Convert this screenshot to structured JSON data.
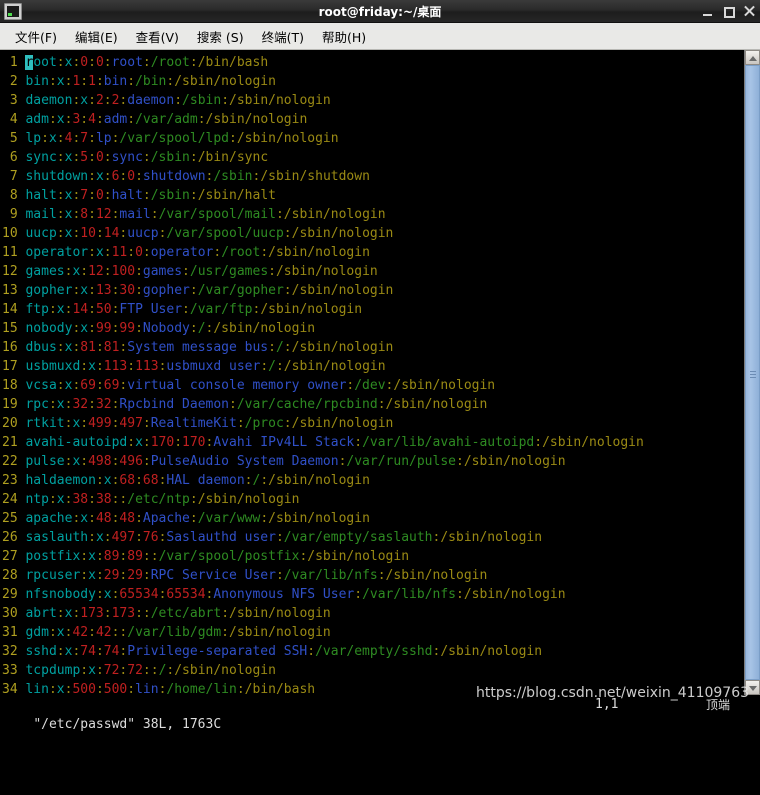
{
  "window": {
    "title": "root@friday:~/桌面",
    "icon": "terminal-icon",
    "buttons": {
      "minimize": "_",
      "maximize": "□",
      "close": "✕"
    }
  },
  "menubar": {
    "items": [
      {
        "label": "文件(F)"
      },
      {
        "label": "编辑(E)"
      },
      {
        "label": "查看(V)"
      },
      {
        "label": "搜索 (S)"
      },
      {
        "label": "终端(T)"
      },
      {
        "label": "帮助(H)"
      }
    ]
  },
  "editor": {
    "program": "vim",
    "colors": {
      "background": "#000000",
      "line_number": "#b0a020",
      "username": "#00a0a0",
      "separator": "#9a8a14",
      "uid_gid": "#c02020",
      "gecos": "#3050c8",
      "home_path": "#2e8b22",
      "shell": "#9a8a14",
      "cursor": "#2fbfbf"
    },
    "cursor": {
      "line": 1,
      "column": 1,
      "char": "r"
    },
    "lines": [
      {
        "n": "1",
        "user": "root",
        "x": "x",
        "uid": "0",
        "gid": "0",
        "gecos": "root",
        "home": "/root",
        "shell": "/bin/bash"
      },
      {
        "n": "2",
        "user": "bin",
        "x": "x",
        "uid": "1",
        "gid": "1",
        "gecos": "bin",
        "home": "/bin",
        "shell": "/sbin/nologin"
      },
      {
        "n": "3",
        "user": "daemon",
        "x": "x",
        "uid": "2",
        "gid": "2",
        "gecos": "daemon",
        "home": "/sbin",
        "shell": "/sbin/nologin"
      },
      {
        "n": "4",
        "user": "adm",
        "x": "x",
        "uid": "3",
        "gid": "4",
        "gecos": "adm",
        "home": "/var/adm",
        "shell": "/sbin/nologin"
      },
      {
        "n": "5",
        "user": "lp",
        "x": "x",
        "uid": "4",
        "gid": "7",
        "gecos": "lp",
        "home": "/var/spool/lpd",
        "shell": "/sbin/nologin"
      },
      {
        "n": "6",
        "user": "sync",
        "x": "x",
        "uid": "5",
        "gid": "0",
        "gecos": "sync",
        "home": "/sbin",
        "shell": "/bin/sync"
      },
      {
        "n": "7",
        "user": "shutdown",
        "x": "x",
        "uid": "6",
        "gid": "0",
        "gecos": "shutdown",
        "home": "/sbin",
        "shell": "/sbin/shutdown"
      },
      {
        "n": "8",
        "user": "halt",
        "x": "x",
        "uid": "7",
        "gid": "0",
        "gecos": "halt",
        "home": "/sbin",
        "shell": "/sbin/halt"
      },
      {
        "n": "9",
        "user": "mail",
        "x": "x",
        "uid": "8",
        "gid": "12",
        "gecos": "mail",
        "home": "/var/spool/mail",
        "shell": "/sbin/nologin"
      },
      {
        "n": "10",
        "user": "uucp",
        "x": "x",
        "uid": "10",
        "gid": "14",
        "gecos": "uucp",
        "home": "/var/spool/uucp",
        "shell": "/sbin/nologin"
      },
      {
        "n": "11",
        "user": "operator",
        "x": "x",
        "uid": "11",
        "gid": "0",
        "gecos": "operator",
        "home": "/root",
        "shell": "/sbin/nologin"
      },
      {
        "n": "12",
        "user": "games",
        "x": "x",
        "uid": "12",
        "gid": "100",
        "gecos": "games",
        "home": "/usr/games",
        "shell": "/sbin/nologin"
      },
      {
        "n": "13",
        "user": "gopher",
        "x": "x",
        "uid": "13",
        "gid": "30",
        "gecos": "gopher",
        "home": "/var/gopher",
        "shell": "/sbin/nologin"
      },
      {
        "n": "14",
        "user": "ftp",
        "x": "x",
        "uid": "14",
        "gid": "50",
        "gecos": "FTP User",
        "home": "/var/ftp",
        "shell": "/sbin/nologin"
      },
      {
        "n": "15",
        "user": "nobody",
        "x": "x",
        "uid": "99",
        "gid": "99",
        "gecos": "Nobody",
        "home": "/",
        "shell": "/sbin/nologin"
      },
      {
        "n": "16",
        "user": "dbus",
        "x": "x",
        "uid": "81",
        "gid": "81",
        "gecos": "System message bus",
        "home": "/",
        "shell": "/sbin/nologin"
      },
      {
        "n": "17",
        "user": "usbmuxd",
        "x": "x",
        "uid": "113",
        "gid": "113",
        "gecos": "usbmuxd user",
        "home": "/",
        "shell": "/sbin/nologin"
      },
      {
        "n": "18",
        "user": "vcsa",
        "x": "x",
        "uid": "69",
        "gid": "69",
        "gecos": "virtual console memory owner",
        "home": "/dev",
        "shell": "/sbin/nologin"
      },
      {
        "n": "19",
        "user": "rpc",
        "x": "x",
        "uid": "32",
        "gid": "32",
        "gecos": "Rpcbind Daemon",
        "home": "/var/cache/rpcbind",
        "shell": "/sbin/nologin"
      },
      {
        "n": "20",
        "user": "rtkit",
        "x": "x",
        "uid": "499",
        "gid": "497",
        "gecos": "RealtimeKit",
        "home": "/proc",
        "shell": "/sbin/nologin"
      },
      {
        "n": "21",
        "user": "avahi-autoipd",
        "x": "x",
        "uid": "170",
        "gid": "170",
        "gecos": "Avahi IPv4LL Stack",
        "home": "/var/lib/avahi-autoipd",
        "shell": "/sbin/nologin"
      },
      {
        "n": "22",
        "user": "pulse",
        "x": "x",
        "uid": "498",
        "gid": "496",
        "gecos": "PulseAudio System Daemon",
        "home": "/var/run/pulse",
        "shell": "/sbin/nologin"
      },
      {
        "n": "23",
        "user": "haldaemon",
        "x": "x",
        "uid": "68",
        "gid": "68",
        "gecos": "HAL daemon",
        "home": "/",
        "shell": "/sbin/nologin"
      },
      {
        "n": "24",
        "user": "ntp",
        "x": "x",
        "uid": "38",
        "gid": "38",
        "gecos": "",
        "home": "/etc/ntp",
        "shell": "/sbin/nologin"
      },
      {
        "n": "25",
        "user": "apache",
        "x": "x",
        "uid": "48",
        "gid": "48",
        "gecos": "Apache",
        "home": "/var/www",
        "shell": "/sbin/nologin"
      },
      {
        "n": "26",
        "user": "saslauth",
        "x": "x",
        "uid": "497",
        "gid": "76",
        "gecos": "Saslauthd user",
        "home": "/var/empty/saslauth",
        "shell": "/sbin/nologin"
      },
      {
        "n": "27",
        "user": "postfix",
        "x": "x",
        "uid": "89",
        "gid": "89",
        "gecos": "",
        "home": "/var/spool/postfix",
        "shell": "/sbin/nologin"
      },
      {
        "n": "28",
        "user": "rpcuser",
        "x": "x",
        "uid": "29",
        "gid": "29",
        "gecos": "RPC Service User",
        "home": "/var/lib/nfs",
        "shell": "/sbin/nologin"
      },
      {
        "n": "29",
        "user": "nfsnobody",
        "x": "x",
        "uid": "65534",
        "gid": "65534",
        "gecos": "Anonymous NFS User",
        "home": "/var/lib/nfs",
        "shell": "/sbin/nologin"
      },
      {
        "n": "30",
        "user": "abrt",
        "x": "x",
        "uid": "173",
        "gid": "173",
        "gecos": "",
        "home": "/etc/abrt",
        "shell": "/sbin/nologin"
      },
      {
        "n": "31",
        "user": "gdm",
        "x": "x",
        "uid": "42",
        "gid": "42",
        "gecos": "",
        "home": "/var/lib/gdm",
        "shell": "/sbin/nologin"
      },
      {
        "n": "32",
        "user": "sshd",
        "x": "x",
        "uid": "74",
        "gid": "74",
        "gecos": "Privilege-separated SSH",
        "home": "/var/empty/sshd",
        "shell": "/sbin/nologin"
      },
      {
        "n": "33",
        "user": "tcpdump",
        "x": "x",
        "uid": "72",
        "gid": "72",
        "gecos": "",
        "home": "/",
        "shell": "/sbin/nologin"
      },
      {
        "n": "34",
        "user": "lin",
        "x": "x",
        "uid": "500",
        "gid": "500",
        "gecos": "lin",
        "home": "/home/lin",
        "shell": "/bin/bash"
      }
    ]
  },
  "statusline": {
    "file_info": "\"/etc/passwd\" 38L, 1763C",
    "position": "1,1",
    "location": "顶端"
  },
  "scrollbar": {
    "up_arrow": "scroll-up-arrow-icon",
    "down_arrow": "scroll-down-arrow-icon"
  },
  "watermark": {
    "text": "https://blog.csdn.net/weixin_41109763"
  }
}
